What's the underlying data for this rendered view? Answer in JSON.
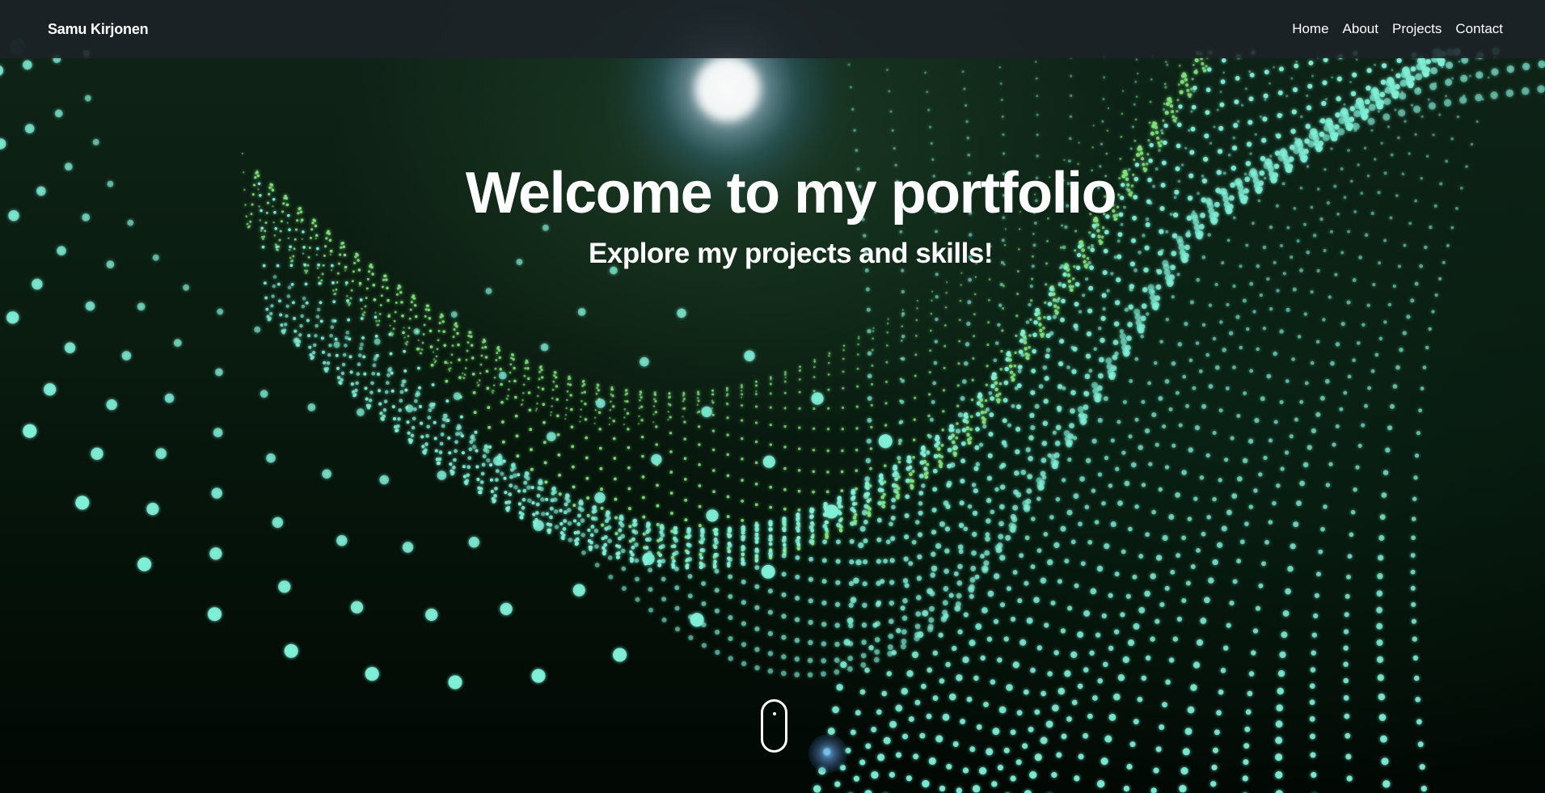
{
  "navbar": {
    "brand": "Samu Kirjonen",
    "links": [
      "Home",
      "About",
      "Projects",
      "Contact"
    ]
  },
  "hero": {
    "title": "Welcome to my portfolio",
    "subtitle": "Explore my projects and skills!"
  },
  "icons": {
    "scroll_indicator": "mouse-scroll-icon"
  },
  "colors": {
    "particle_glow": "#7ff0d6",
    "particle_green": "#7fe07a",
    "navbar_bg": "#1c2228",
    "text": "#ffffff"
  }
}
